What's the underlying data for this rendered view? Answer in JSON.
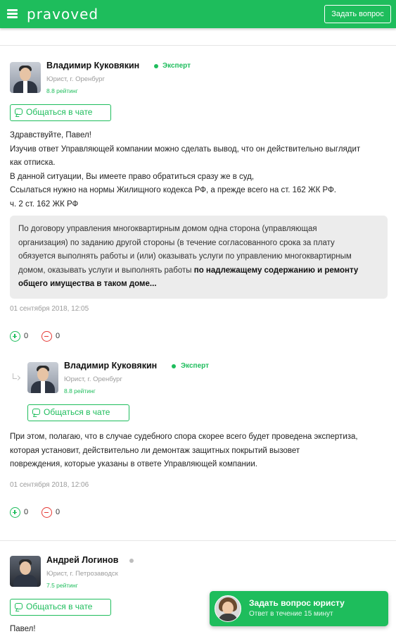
{
  "header": {
    "logo": "pravoved",
    "ask_button": "Задать вопрос"
  },
  "answer1": {
    "author": "Владимир Куковякин",
    "badge": "Эксперт",
    "meta": "Юрист, г. Оренбург",
    "rating": "8.8 рейтинг",
    "chat_button": "Общаться в чате",
    "paragraphs": [
      "Здравствуйте, Павел!",
      "Изучив ответ Управляющей компании можно сделать вывод, что он действительно выглядит",
      "как отписка.",
      "В данной ситуации, Вы имеете право обратиться сразу же в суд,",
      "Ссылаться нужно на нормы Жилищного кодекса РФ, а прежде всего на ст. 162 ЖК РФ.",
      "ч. 2 ст. 162 ЖК РФ"
    ],
    "quote_lines": [
      "По договору управления многоквартирным домом одна сторона (управляющая",
      "организация) по заданию другой стороны (в течение согласованного срока за плату",
      "обязуется выполнять работы и (или) оказывать услуги по управлению многоквартирным"
    ],
    "quote_line4": "домом, оказывать услуги и выполнять работы ",
    "quote_bold1": "по надлежащему содержанию и ремонту",
    "quote_bold2": "общего имущества в таком доме...",
    "date": "01 сентября 2018, 12:05",
    "votes_up": "0",
    "votes_down": "0"
  },
  "reply1": {
    "author": "Владимир Куковякин",
    "badge": "Эксперт",
    "meta": "Юрист, г. Оренбург",
    "rating": "8.8 рейтинг",
    "chat_button": "Общаться в чате",
    "paragraphs": [
      "При этом, полагаю, что в случае судебного спора скорее всего будет проведена экспертиза,",
      "которая установит, действительно ли демонтаж защитных покрытий вызовет",
      "повреждения, которые указаны в ответе Управляющей компании."
    ],
    "date": "01 сентября 2018, 12:06",
    "votes_up": "0",
    "votes_down": "0"
  },
  "answer2": {
    "author": "Андрей Логинов",
    "meta": "Юрист, г. Петрозаводск",
    "rating": "7.5 рейтинг",
    "chat_button": "Общаться в чате",
    "first_line": "Павел!"
  },
  "float_cta": {
    "title": "Задать вопрос юристу",
    "subtitle": "Ответ в течение 15 минут"
  },
  "colors": {
    "brand_green": "#1ebd5c",
    "downvote_red": "#e53935"
  }
}
